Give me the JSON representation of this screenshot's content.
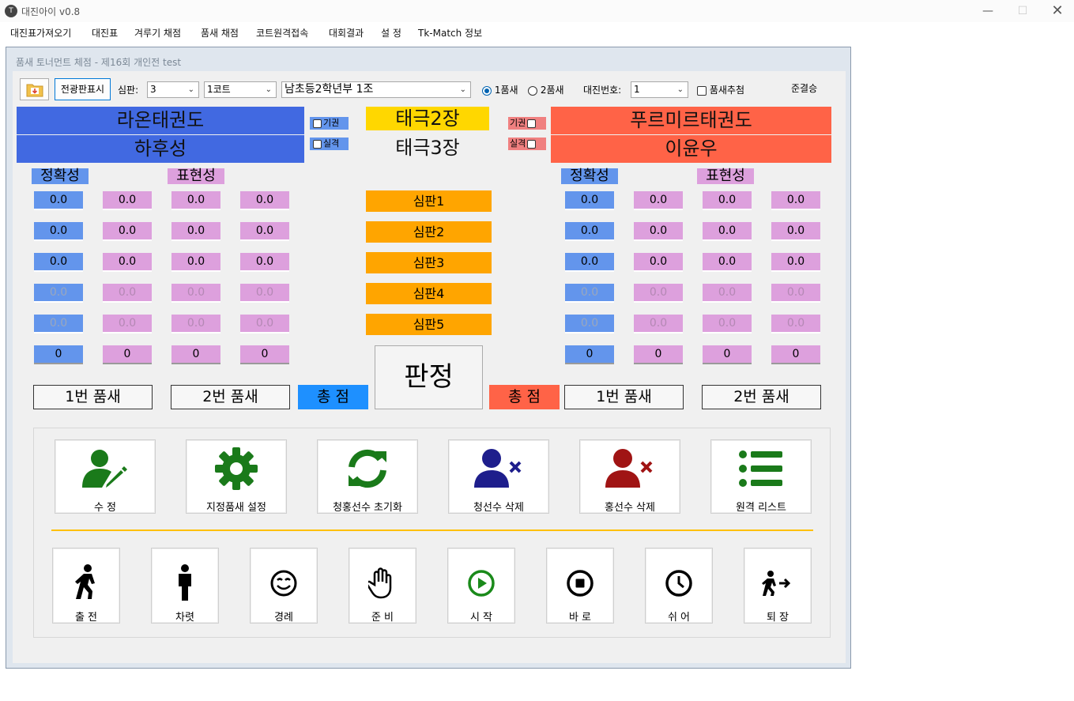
{
  "window": {
    "title": "대진아이  v0.8",
    "icon_text": "T"
  },
  "menu": [
    "대진표가져오기",
    "대진표",
    "겨루기 채점",
    "품새 채점",
    "코트원격접속",
    "대회결과",
    "설 정",
    "Tk-Match 정보"
  ],
  "child_title": "품새 토너먼트 체점 - 제16회 개인전 test",
  "toolbar": {
    "display_button": "전광판표시",
    "judges_label": "심판:",
    "judges_value": "3",
    "court_value": "1코트",
    "division_value": "남초등2학년부 1조",
    "radio1_label": "1품새",
    "radio2_label": "2품새",
    "match_no_label": "대진번호:",
    "match_no_value": "1",
    "draw_label": "품새추첨",
    "stage_label": "준결승"
  },
  "blue": {
    "team": "라온태권도",
    "name": "하후성",
    "color": "#4169e1",
    "tag_abstain": "기권",
    "tag_disq": "실격"
  },
  "red": {
    "team": "푸르미르태권도",
    "name": "이윤우",
    "color": "#ff6347",
    "tag_abstain": "기권",
    "tag_disq": "실격"
  },
  "poomsae": {
    "first": "태극2장",
    "second": "태극3장"
  },
  "headers": {
    "accuracy": "정확성",
    "presentation": "표현성"
  },
  "judges": [
    "심판1",
    "심판2",
    "심판3",
    "심판4",
    "심판5"
  ],
  "blue_scores": [
    [
      "0.0",
      "0.0",
      "0.0",
      "0.0"
    ],
    [
      "0.0",
      "0.0",
      "0.0",
      "0.0"
    ],
    [
      "0.0",
      "0.0",
      "0.0",
      "0.0"
    ],
    [
      "0.0",
      "0.0",
      "0.0",
      "0.0"
    ],
    [
      "0.0",
      "0.0",
      "0.0",
      "0.0"
    ]
  ],
  "blue_totals": [
    "0",
    "0",
    "0",
    "0"
  ],
  "red_scores": [
    [
      "0.0",
      "0.0",
      "0.0",
      "0.0"
    ],
    [
      "0.0",
      "0.0",
      "0.0",
      "0.0"
    ],
    [
      "0.0",
      "0.0",
      "0.0",
      "0.0"
    ],
    [
      "0.0",
      "0.0",
      "0.0",
      "0.0"
    ],
    [
      "0.0",
      "0.0",
      "0.0",
      "0.0"
    ]
  ],
  "red_totals": [
    "0",
    "0",
    "0",
    "0"
  ],
  "bottom_buttons": {
    "p1": "1번 품새",
    "p2": "2번 품새",
    "total": "총 점",
    "verdict": "판정"
  },
  "actions_top": [
    {
      "label": "수      정",
      "icon": "user-edit-icon"
    },
    {
      "label": "지정품새 설정",
      "icon": "gear-icon"
    },
    {
      "label": "청홍선수 초기화",
      "icon": "refresh-icon"
    },
    {
      "label": "청선수 삭제",
      "icon": "user-remove-blue-icon"
    },
    {
      "label": "홍선수 삭제",
      "icon": "user-remove-red-icon"
    },
    {
      "label": "원격 리스트",
      "icon": "list-icon"
    }
  ],
  "actions_bottom": [
    {
      "label": "출  전",
      "icon": "walking-person-icon"
    },
    {
      "label": "차렷",
      "icon": "standing-person-icon"
    },
    {
      "label": "경례",
      "icon": "smile-icon"
    },
    {
      "label": "준  비",
      "icon": "hand-icon"
    },
    {
      "label": "시  작",
      "icon": "play-icon"
    },
    {
      "label": "바  로",
      "icon": "stop-icon"
    },
    {
      "label": "쉬  어",
      "icon": "clock-icon"
    },
    {
      "label": "퇴  장",
      "icon": "exit-icon"
    }
  ],
  "colors": {
    "judge": "#ffa500",
    "poomsae_first": "#ffd700",
    "accuracy_box": "#6395ec",
    "presentation_box": "#dda0dd",
    "divider": "#ffc000",
    "icon_green": "#1a7a1a",
    "icon_navy": "#1e1e8c",
    "icon_darkred": "#a01414"
  }
}
